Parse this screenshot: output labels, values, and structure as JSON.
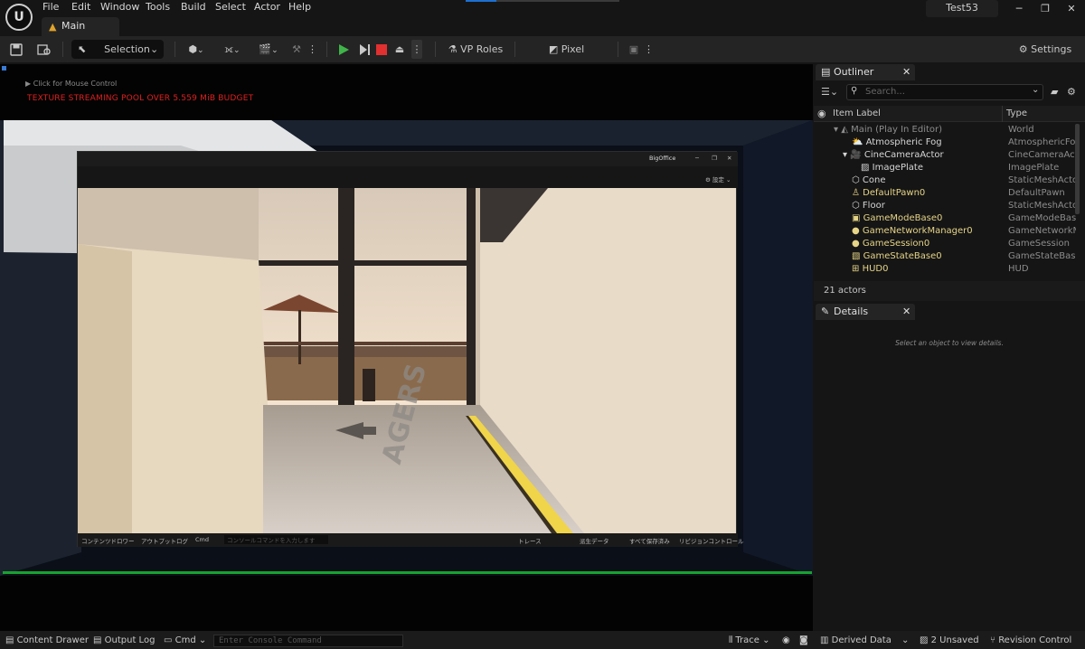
{
  "menubar": {
    "items": [
      "File",
      "Edit",
      "Window",
      "Tools",
      "Build",
      "Select",
      "Actor",
      "Help"
    ],
    "tab_label": "Main",
    "project_name": "Test53"
  },
  "toolbar": {
    "selection_mode": "Selection Mode",
    "vp_roles": "VP Roles",
    "pixel_streaming": "Pixel Streaming",
    "settings": "Settings"
  },
  "viewport": {
    "mouse_hint": "Click for Mouse Control",
    "warning": "TEXTURE STREAMING POOL OVER 5.559 MiB BUDGET",
    "warning_color": "#e02020",
    "inner_window": {
      "title": "BigOffice",
      "settings_label": "設定",
      "floor_text": "AGERS",
      "bottom_items": [
        "コンテンツドロワー",
        "アウトプットログ",
        "Cmd",
        "コンソールコマンドを入力します",
        "トレース",
        "派生データ",
        "すべて保存済み",
        "リビジョンコントロール"
      ]
    }
  },
  "outliner": {
    "tab": "Outliner",
    "search_placeholder": "Search...",
    "col_label": "Item Label",
    "col_type": "Type",
    "rows": [
      {
        "label": "Main (Play In Editor)",
        "type": "World"
      },
      {
        "label": "Atmospheric Fog",
        "type": "AtmosphericFog"
      },
      {
        "label": "CineCameraActor",
        "type": "CineCameraActor"
      },
      {
        "label": "ImagePlate",
        "type": "ImagePlate"
      },
      {
        "label": "Cone",
        "type": "StaticMeshActor"
      },
      {
        "label": "DefaultPawn0",
        "type": "DefaultPawn"
      },
      {
        "label": "Floor",
        "type": "StaticMeshActor"
      },
      {
        "label": "GameModeBase0",
        "type": "GameModeBase"
      },
      {
        "label": "GameNetworkManager0",
        "type": "GameNetworkMa"
      },
      {
        "label": "GameSession0",
        "type": "GameSession"
      },
      {
        "label": "GameStateBase0",
        "type": "GameStateBase"
      },
      {
        "label": "HUD0",
        "type": "HUD"
      }
    ],
    "actor_count": "21 actors"
  },
  "details": {
    "tab": "Details",
    "empty_text": "Select an object to view details."
  },
  "statusbar": {
    "content_drawer": "Content Drawer",
    "output_log": "Output Log",
    "cmd": "Cmd",
    "console_placeholder": "Enter Console Command",
    "trace": "Trace",
    "derived_data": "Derived Data",
    "unsaved": "2 Unsaved",
    "revision_control": "Revision Control"
  }
}
